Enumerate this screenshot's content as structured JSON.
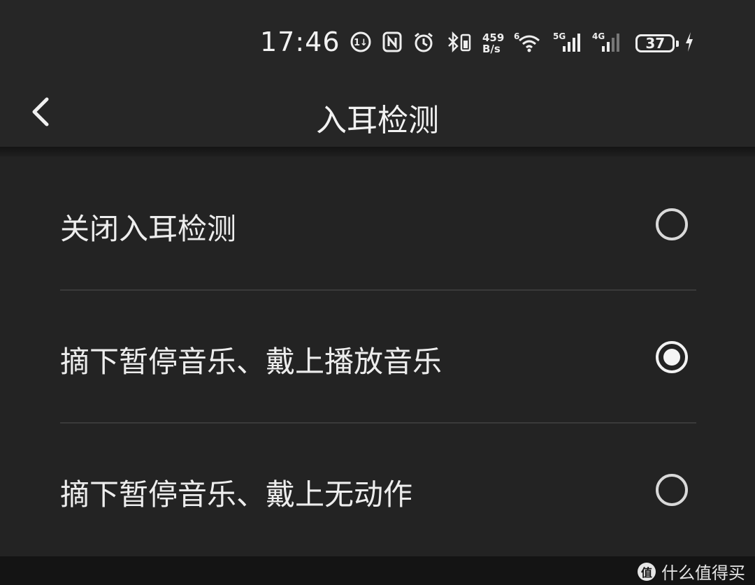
{
  "status_bar": {
    "time": "17:46",
    "speed_value": "459",
    "speed_unit": "B/s",
    "battery": "37",
    "icons": [
      "data-saver-icon",
      "nfc-icon",
      "alarm-icon",
      "bluetooth-icon",
      "wifi-icon",
      "signal-5g-icon",
      "signal-4g-icon",
      "battery-icon",
      "charging-icon"
    ],
    "signal_5g": "5G",
    "signal_4g": "4G",
    "wifi_index": "6"
  },
  "header": {
    "title": "入耳检测"
  },
  "options": [
    {
      "label": "关闭入耳检测",
      "selected": false
    },
    {
      "label": "摘下暂停音乐、戴上播放音乐",
      "selected": true
    },
    {
      "label": "摘下暂停音乐、戴上无动作",
      "selected": false
    }
  ],
  "watermark": {
    "text": "什么值得买",
    "logo": "值"
  }
}
